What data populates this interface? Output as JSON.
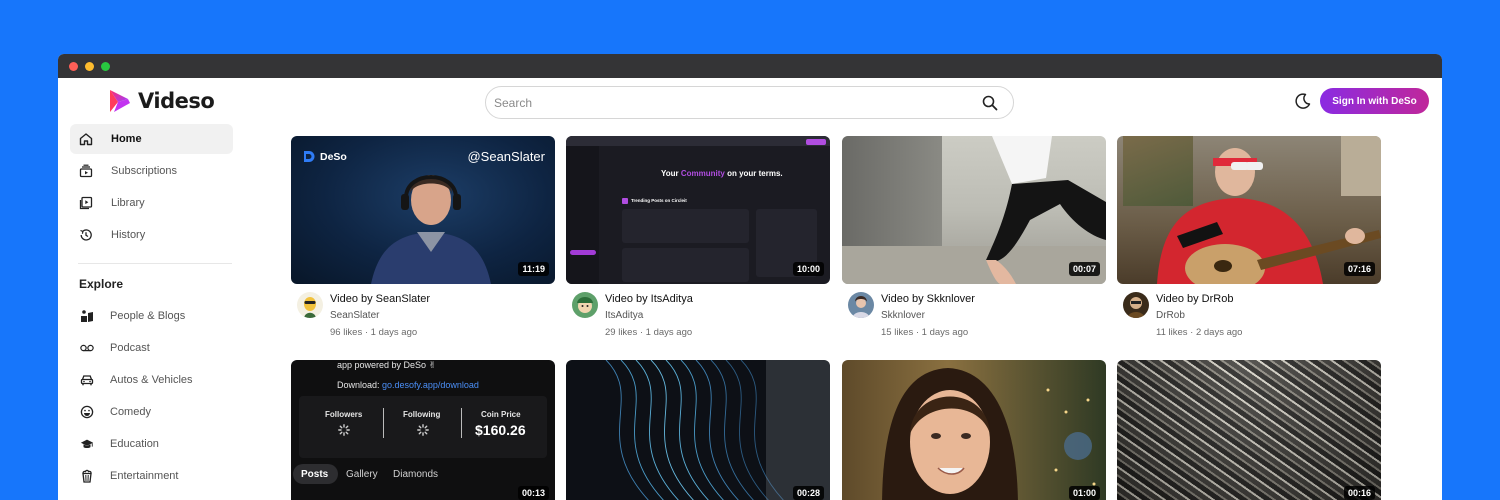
{
  "app": {
    "name": "Videso"
  },
  "nav": {
    "items": [
      {
        "label": "Home",
        "icon": "home-icon",
        "active": true
      },
      {
        "label": "Subscriptions",
        "icon": "subscriptions-icon"
      },
      {
        "label": "Library",
        "icon": "library-icon"
      },
      {
        "label": "History",
        "icon": "history-icon"
      }
    ],
    "explore_title": "Explore",
    "explore": [
      {
        "label": "People & Blogs",
        "icon": "people-blogs-icon"
      },
      {
        "label": "Podcast",
        "icon": "podcast-icon"
      },
      {
        "label": "Autos & Vehicles",
        "icon": "car-icon"
      },
      {
        "label": "Comedy",
        "icon": "comedy-icon"
      },
      {
        "label": "Education",
        "icon": "education-icon"
      },
      {
        "label": "Entertainment",
        "icon": "entertainment-icon"
      }
    ]
  },
  "search": {
    "placeholder": "Search"
  },
  "header": {
    "sign_in_label": "Sign In with DeSo"
  },
  "colors": {
    "background": "#1776fb",
    "accent_start": "#8a2be2",
    "accent_end": "#c0279a"
  },
  "videos": [
    {
      "title": "Video by SeanSlater",
      "channel": "SeanSlater",
      "stats": "96 likes · 1 days ago",
      "duration": "11:19",
      "thumb_text": {
        "brand": "DeSo",
        "handle": "@SeanSlater"
      }
    },
    {
      "title": "Video by ItsAditya",
      "channel": "ItsAditya",
      "stats": "29 likes · 1 days ago",
      "duration": "10:00",
      "thumb_text": {
        "headline_pre": "Your ",
        "headline_em": "Community",
        "headline_post": " on your terms.",
        "section": "Trending Posts on Circleit"
      }
    },
    {
      "title": "Video by Skknlover",
      "channel": "Skknlover",
      "stats": "15 likes · 1 days ago",
      "duration": "00:07"
    },
    {
      "title": "Video by DrRob",
      "channel": "DrRob",
      "stats": "11 likes · 2 days ago",
      "duration": "07:16"
    },
    {
      "duration": "00:13",
      "thumb_text": {
        "line1": "app powered by DeSo ✌",
        "download_label": "Download: ",
        "download_link": "go.desofy.app/download",
        "followers": "Followers",
        "following": "Following",
        "coin_price_label": "Coin Price",
        "coin_price": "$160.26",
        "tabs": [
          "Posts",
          "Gallery",
          "Diamonds"
        ]
      }
    },
    {
      "duration": "00:28"
    },
    {
      "duration": "01:00"
    },
    {
      "duration": "00:16"
    }
  ]
}
